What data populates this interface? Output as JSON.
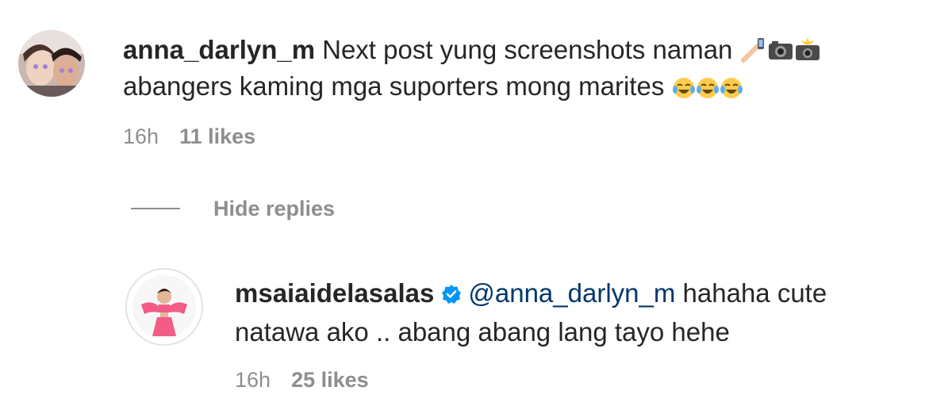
{
  "comments": [
    {
      "username": "anna_darlyn_m",
      "text_line1": "Next post yung screenshots naman",
      "text_line2": "abangers kaming mga suporters mong marites",
      "emojis_line1": [
        "selfie-arm-icon",
        "camera-icon",
        "camera-flash-icon"
      ],
      "emojis_line2": [
        "tears-of-joy-icon",
        "tears-of-joy-icon",
        "tears-of-joy-icon"
      ],
      "time": "16h",
      "likes": "11 likes"
    },
    {
      "username": "msaiaidelasalas",
      "verified": true,
      "mention": "@anna_darlyn_m",
      "text_line1": "hahaha cute",
      "text_line2": "natawa ako .. abang abang lang tayo hehe",
      "time": "16h",
      "likes": "25 likes"
    }
  ],
  "replies_toggle": {
    "label": "Hide replies"
  },
  "colors": {
    "text": "#262626",
    "secondary": "#8e8e8e",
    "mention": "#00376b",
    "verified": "#0095f6"
  }
}
